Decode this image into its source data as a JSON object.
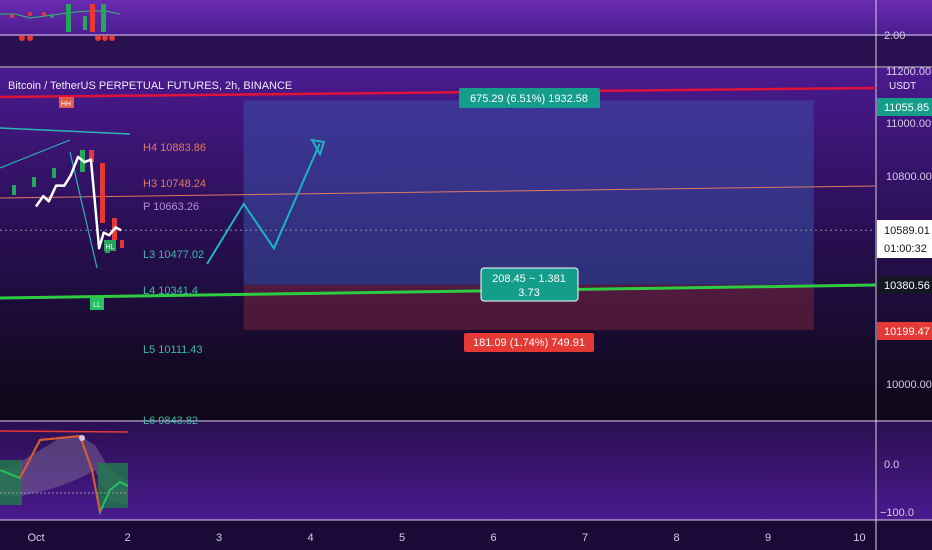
{
  "header": {
    "title": "Bitcoin / TetherUS PERPETUAL FUTURES, 2h, BINANCE"
  },
  "top_pane": {
    "scale_label": "2.00"
  },
  "price_axis": {
    "unit": "USDT",
    "ticks": [
      "11200.00",
      "11000.00",
      "10800.00",
      "10000.00"
    ],
    "badges": {
      "target": "11055.85",
      "last": "10589.01",
      "countdown": "01:00:32",
      "green_line": "10380.56",
      "stop": "10199.47"
    }
  },
  "time_axis": {
    "labels": [
      "Oct",
      "2",
      "3",
      "4",
      "5",
      "6",
      "7",
      "8",
      "9",
      "10"
    ]
  },
  "pivots": {
    "h4": "H4 10883.86",
    "h3": "H3 10748.24",
    "p": "P 10663.26",
    "l3": "L3 10477.02",
    "l4": "L4 10341.4",
    "l5": "L5 10111.43",
    "l6": "L6 9843.82"
  },
  "markers": {
    "higher_high": "HH",
    "lower_low": "LL",
    "higher_low": "HL"
  },
  "position_tool": {
    "target_label": "675.29 (6.51%) 1932.58",
    "ratio_label_1": "208.45 ~ 1.381",
    "ratio_label_2": "3.73",
    "stop_label": "181.09 (1.74%) 749.91"
  },
  "oscillator": {
    "ticks": [
      "0.0",
      "−100.0"
    ]
  },
  "chart_data": {
    "type": "line",
    "title": "Bitcoin / TetherUS PERPETUAL FUTURES, 2h, BINANCE",
    "y_unit": "USDT",
    "ylim": [
      9880,
      11260
    ],
    "x_range": [
      "Oct 1",
      "Oct 10"
    ],
    "price_path": [
      [
        1.0,
        10680
      ],
      [
        1.08,
        10720
      ],
      [
        1.14,
        10700
      ],
      [
        1.22,
        10760
      ],
      [
        1.31,
        10760
      ],
      [
        1.38,
        10800
      ],
      [
        1.46,
        10870
      ],
      [
        1.53,
        10850
      ],
      [
        1.6,
        10860
      ],
      [
        1.63,
        10750
      ],
      [
        1.69,
        10520
      ],
      [
        1.74,
        10580
      ],
      [
        1.8,
        10570
      ],
      [
        1.87,
        10600
      ],
      [
        1.93,
        10589
      ]
    ],
    "levels": [
      {
        "name": "H4",
        "value": 10883.86
      },
      {
        "name": "H3",
        "value": 10748.24
      },
      {
        "name": "P",
        "value": 10663.26
      },
      {
        "name": "L3",
        "value": 10477.02
      },
      {
        "name": "L4",
        "value": 10341.4
      },
      {
        "name": "L5",
        "value": 10111.43
      },
      {
        "name": "L6",
        "value": 9843.82
      }
    ],
    "position": {
      "entry": 10380.56,
      "target": 11055.85,
      "stop": 10199.47,
      "from": 3.27,
      "to": 9.5
    },
    "projection": [
      [
        2.87,
        10460
      ],
      [
        3.27,
        10690
      ],
      [
        3.6,
        10520
      ],
      [
        4.1,
        10920
      ]
    ],
    "grid": false
  }
}
